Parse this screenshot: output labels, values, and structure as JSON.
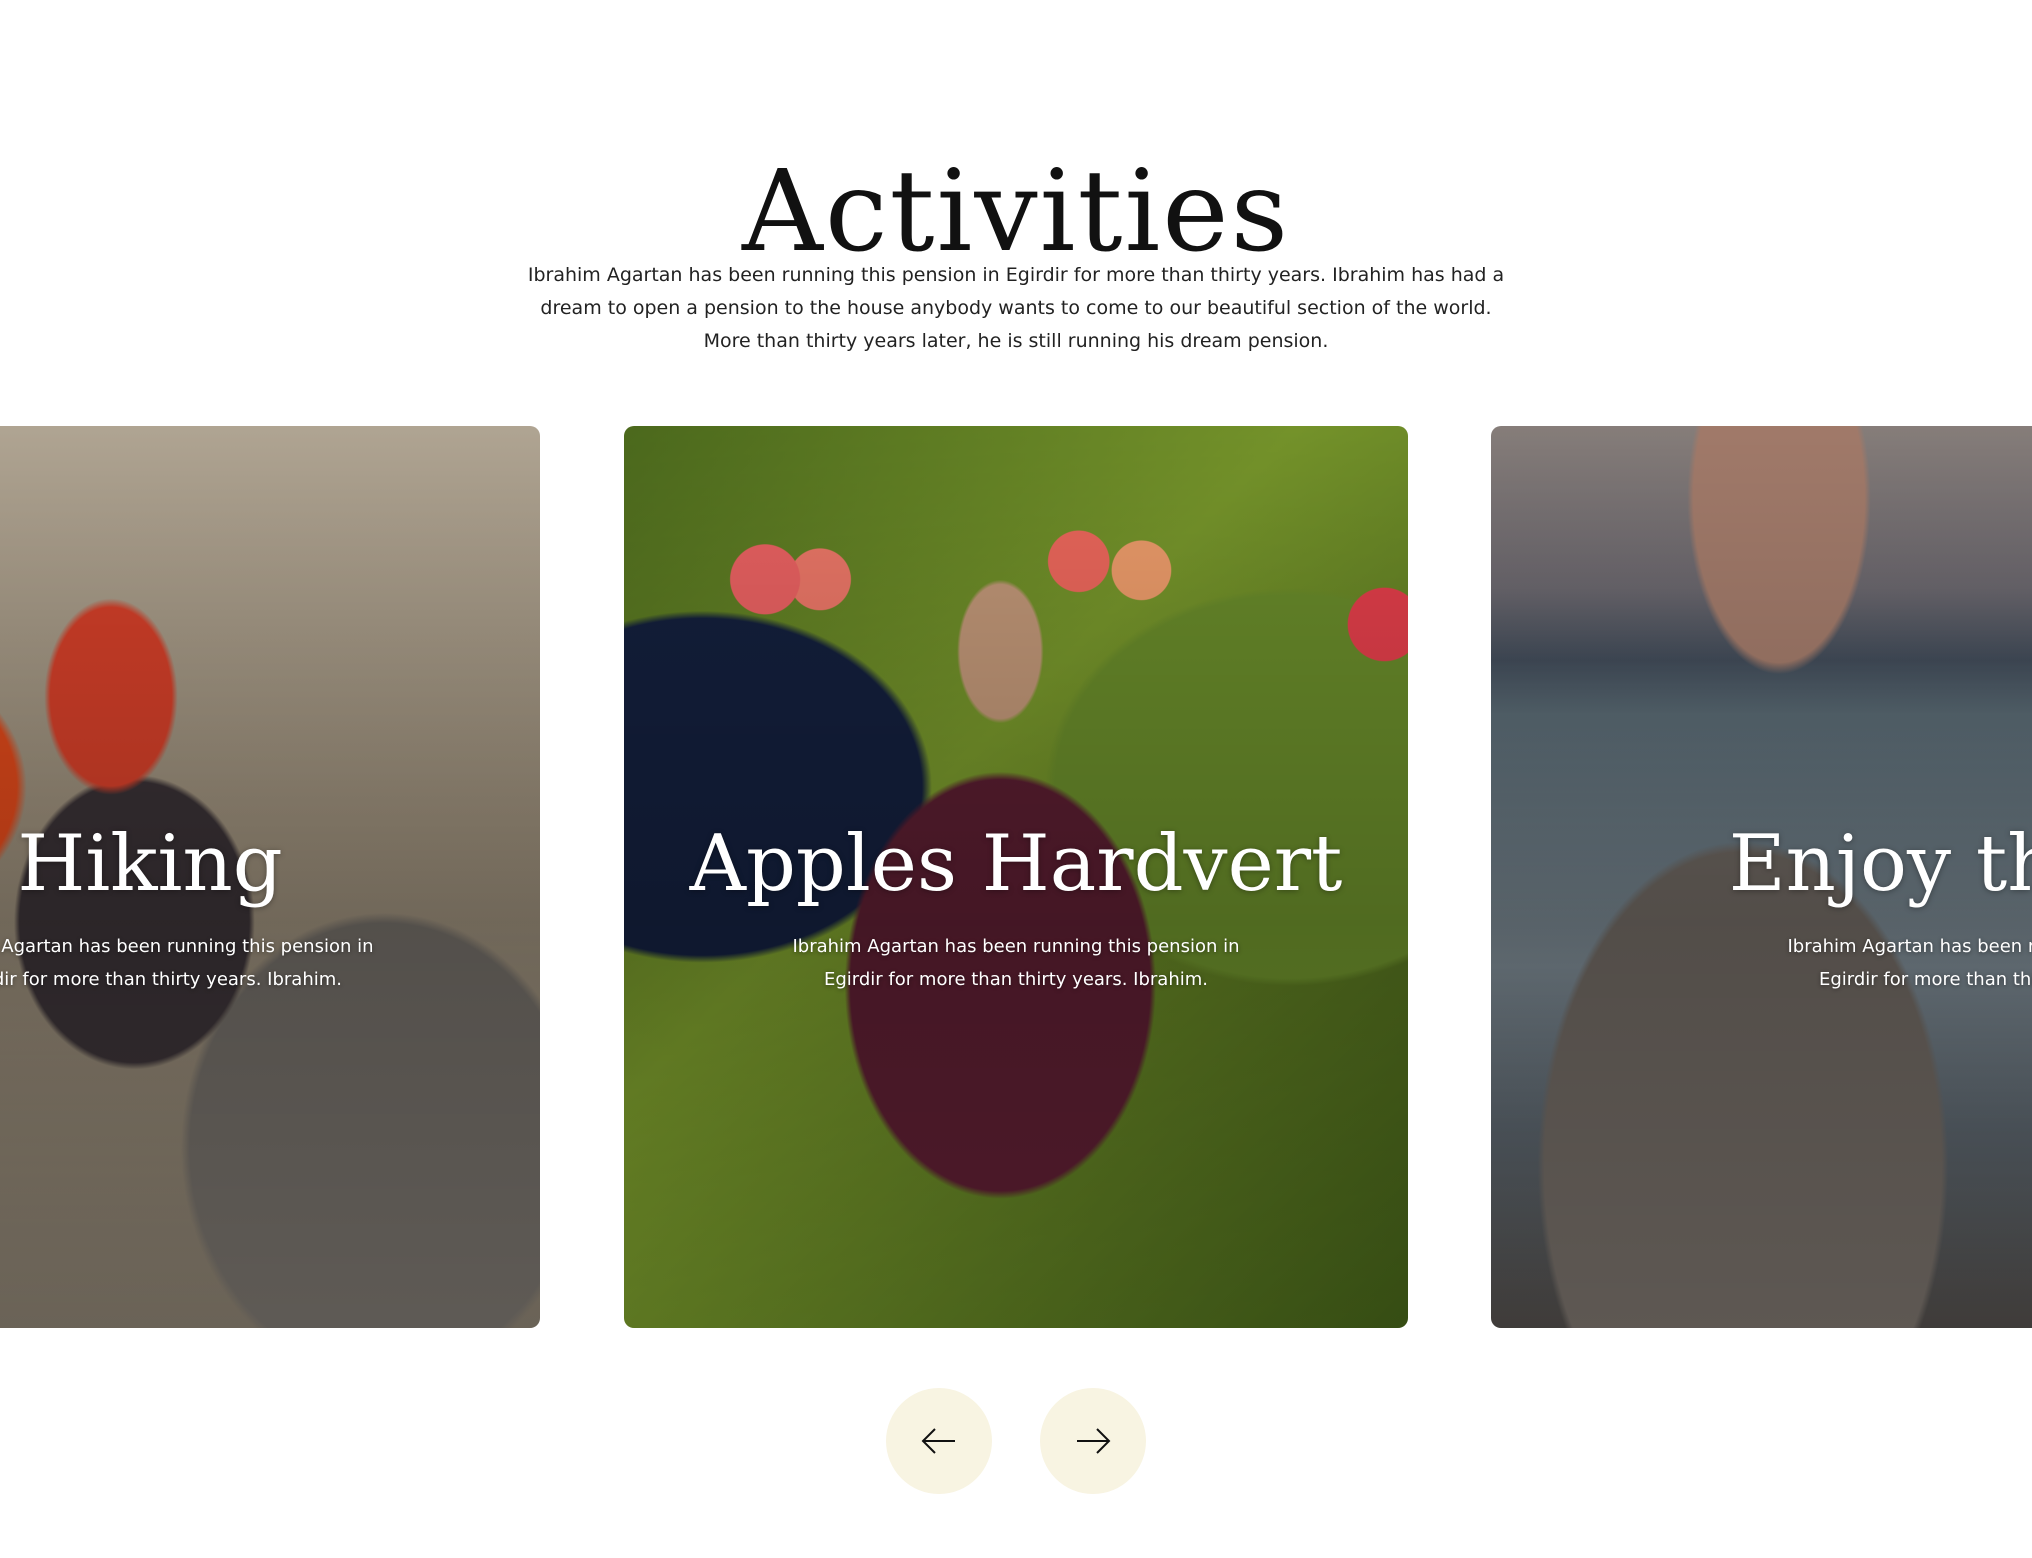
{
  "section": {
    "title": "Activities",
    "intro": "Ibrahim Agartan has been running this pension in Egirdir for more than thirty years. Ibrahim has had a dream to open a pension to the house anybody wants to come to our beautiful section of the world. More than thirty years later, he is still running his dream pension."
  },
  "cards": [
    {
      "title": "Hiking",
      "description": "Ibrahim Agartan has been running this pension in Egirdir for more than thirty years. Ibrahim."
    },
    {
      "title": "Apples Hardvert",
      "description": "Ibrahim Agartan has been running this pension in Egirdir for more than thirty years. Ibrahim."
    },
    {
      "title": "Enjoy the lake",
      "description": "Ibrahim Agartan has been running this pension in Egirdir for more than thirty years. Ibrahim."
    }
  ],
  "navigation": {
    "prev_icon": "arrow-left-icon",
    "next_icon": "arrow-right-icon"
  },
  "colors": {
    "nav_button_bg": "#f8f4e2",
    "text": "#111111",
    "card_text": "#ffffff"
  }
}
